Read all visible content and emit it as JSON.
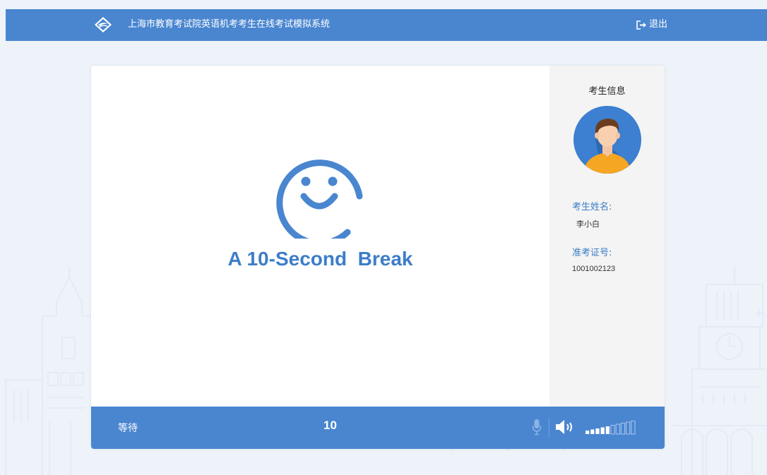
{
  "header": {
    "title": "上海市教育考试院英语机考考生在线考试模拟系统",
    "logout_label": "退出"
  },
  "main": {
    "message": "A 10-Second  Break"
  },
  "candidate": {
    "section_title": "考生信息",
    "name_label": "考生姓名:",
    "name_value": "李小白",
    "id_label": "准考证号:",
    "id_value": "1001002123"
  },
  "footer": {
    "status": "等待",
    "countdown": "10",
    "volume_level": 0.5
  },
  "colors": {
    "brand_blue": "#4a86d0",
    "text_blue": "#3d7dc8",
    "background": "#eef3f9"
  }
}
